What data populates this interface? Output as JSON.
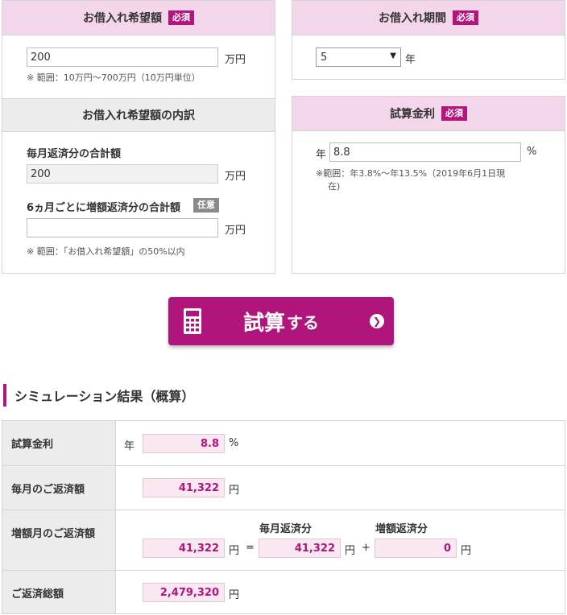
{
  "loan_amount": {
    "heading": "お借入れ希望額",
    "badge": "必須",
    "value": "200",
    "unit": "万円",
    "note": "※ 範囲：10万円〜700万円（10万円単位）"
  },
  "breakdown": {
    "heading": "お借入れ希望額の内訳",
    "monthly_label": "毎月返済分の合計額",
    "monthly_value": "200",
    "monthly_unit": "万円",
    "bonus_label": "6ヵ月ごとに増額返済分の合計額",
    "bonus_badge": "任意",
    "bonus_value": "",
    "bonus_unit": "万円",
    "bonus_note": "※ 範囲：「お借入れ希望額」の50%以内"
  },
  "period": {
    "heading": "お借入れ期間",
    "badge": "必須",
    "selected": "5",
    "unit": "年"
  },
  "rate": {
    "heading": "試算金利",
    "badge": "必須",
    "prefix": "年",
    "value": "8.8",
    "unit": "%",
    "note_line1": "※範囲：年3.8%〜年13.5%（2019年6月1日現",
    "note_line2": "在)"
  },
  "calc_button": {
    "label_big": "試算",
    "label_small": "する"
  },
  "results": {
    "title": "シミュレーション結果（概算）",
    "rate_label": "試算金利",
    "rate_prefix": "年",
    "rate_value": "8.8",
    "rate_unit": "%",
    "monthly_label": "毎月のご返済額",
    "monthly_value": "41,322",
    "monthly_unit": "円",
    "bonus_month_label": "増額月のご返済額",
    "bonus_month_value": "41,322",
    "bonus_month_unit": "円",
    "equals": "=",
    "sub_monthly_head": "毎月返済分",
    "sub_monthly_value": "41,322",
    "sub_monthly_unit": "円",
    "plus": "+",
    "sub_bonus_head": "増額返済分",
    "sub_bonus_value": "0",
    "sub_bonus_unit": "円",
    "total_label": "ご返済総額",
    "total_value": "2,479,320",
    "total_unit": "円"
  },
  "colors": {
    "accent": "#b0157b",
    "header_pink": "#f4d6ea",
    "header_gray": "#ececec",
    "value_bg": "#f9e7f2"
  }
}
